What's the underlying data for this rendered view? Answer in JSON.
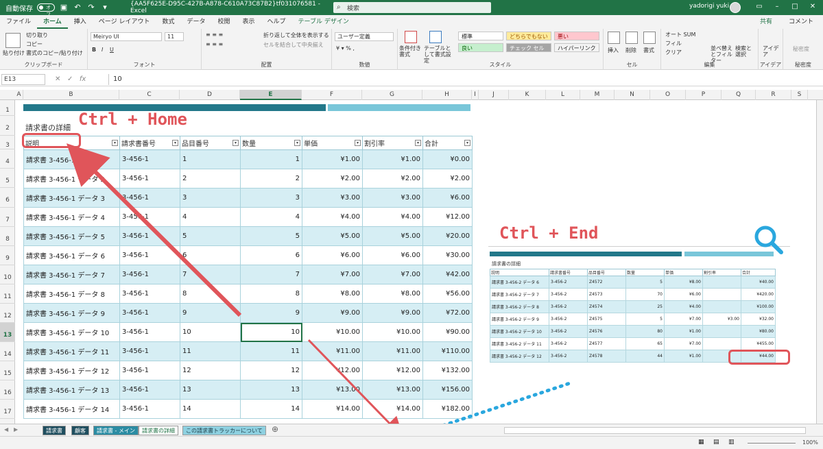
{
  "titlebar": {
    "autosave_label": "自動保存",
    "autosave_state": "オフ",
    "doc_title": "{AA5F625E-D95C-427B-A878-C610A73C87B2}tf031076581  -  Excel",
    "search_placeholder": "検索",
    "user_name": "yadorigi yuki"
  },
  "ribbon_tabs": [
    "ファイル",
    "ホーム",
    "挿入",
    "ページ レイアウト",
    "数式",
    "データ",
    "校閲",
    "表示",
    "ヘルプ",
    "テーブル デザイン"
  ],
  "ribbon_actions": {
    "share": "共有",
    "comment": "コメント"
  },
  "ribbon": {
    "clipboard": {
      "paste": "貼り付け",
      "cut": "切り取り",
      "copy": "コピー",
      "format_painter": "書式のコピー/貼り付け",
      "label": "クリップボード"
    },
    "font": {
      "font_name": "Meiryo UI",
      "font_size": "11",
      "label": "フォント"
    },
    "alignment": {
      "wrap": "折り返して全体を表示する",
      "merge": "セルを結合して中央揃え",
      "label": "配置"
    },
    "number": {
      "format": "ユーザー定義",
      "label": "数値"
    },
    "styles": {
      "conditional": "条件付き書式",
      "format_as_table": "テーブルとして書式設定",
      "cells": [
        {
          "text": "標準",
          "bg": "#ffffff",
          "fg": "#222222"
        },
        {
          "text": "どちらでもない",
          "bg": "#ffeb9c",
          "fg": "#9c5700"
        },
        {
          "text": "悪い",
          "bg": "#ffc7ce",
          "fg": "#9c0006"
        },
        {
          "text": "良い",
          "bg": "#c6efce",
          "fg": "#006100"
        },
        {
          "text": "チェック セル",
          "bg": "#a5a5a5",
          "fg": "#ffffff"
        },
        {
          "text": "ハイパーリンク",
          "bg": "#f3f3f3",
          "fg": "#222222"
        }
      ],
      "label": "スタイル"
    },
    "cells": {
      "insert": "挿入",
      "delete": "削除",
      "format": "書式",
      "label": "セル"
    },
    "editing": {
      "autosum": "オート SUM",
      "fill": "フィル",
      "clear": "クリア",
      "sort": "並べ替えとフィルター",
      "find": "検索と選択",
      "label": "編集"
    },
    "ideas": {
      "text": "アイデア",
      "label": "アイデア"
    },
    "sensitivity": {
      "text": "秘密度",
      "label": "秘密度"
    }
  },
  "formula_bar": {
    "name_box": "E13",
    "fx": "fx",
    "value": "10"
  },
  "columns": [
    "A",
    "B",
    "C",
    "D",
    "E",
    "F",
    "G",
    "H",
    "I",
    "J",
    "K",
    "L",
    "M",
    "N",
    "O",
    "P",
    "Q",
    "R",
    "S"
  ],
  "rows": [
    "1",
    "2",
    "3",
    "4",
    "5",
    "6",
    "7",
    "8",
    "9",
    "10",
    "11",
    "12",
    "13",
    "14",
    "15",
    "16",
    "17"
  ],
  "sheet": {
    "title": "請求書の詳細",
    "headers": [
      "説明",
      "請求書番号",
      "品目番号",
      "数量",
      "単価",
      "割引率",
      "合計"
    ],
    "rows": [
      [
        "請求書 3-456-1 データ 1",
        "3-456-1",
        "1",
        "1",
        "¥1.00",
        "¥1.00",
        "¥0.00"
      ],
      [
        "請求書 3-456-1 データ 2",
        "3-456-1",
        "2",
        "2",
        "¥2.00",
        "¥2.00",
        "¥2.00"
      ],
      [
        "請求書 3-456-1 データ 3",
        "3-456-1",
        "3",
        "3",
        "¥3.00",
        "¥3.00",
        "¥6.00"
      ],
      [
        "請求書 3-456-1 データ 4",
        "3-456-1",
        "4",
        "4",
        "¥4.00",
        "¥4.00",
        "¥12.00"
      ],
      [
        "請求書 3-456-1 データ 5",
        "3-456-1",
        "5",
        "5",
        "¥5.00",
        "¥5.00",
        "¥20.00"
      ],
      [
        "請求書 3-456-1 データ 6",
        "3-456-1",
        "6",
        "6",
        "¥6.00",
        "¥6.00",
        "¥30.00"
      ],
      [
        "請求書 3-456-1 データ 7",
        "3-456-1",
        "7",
        "7",
        "¥7.00",
        "¥7.00",
        "¥42.00"
      ],
      [
        "請求書 3-456-1 データ 8",
        "3-456-1",
        "8",
        "8",
        "¥8.00",
        "¥8.00",
        "¥56.00"
      ],
      [
        "請求書 3-456-1 データ 9",
        "3-456-1",
        "9",
        "9",
        "¥9.00",
        "¥9.00",
        "¥72.00"
      ],
      [
        "請求書 3-456-1 データ 10",
        "3-456-1",
        "10",
        "10",
        "¥10.00",
        "¥10.00",
        "¥90.00"
      ],
      [
        "請求書 3-456-1 データ 11",
        "3-456-1",
        "11",
        "11",
        "¥11.00",
        "¥11.00",
        "¥110.00"
      ],
      [
        "請求書 3-456-1 データ 12",
        "3-456-1",
        "12",
        "12",
        "¥12.00",
        "¥12.00",
        "¥132.00"
      ],
      [
        "請求書 3-456-1 データ 13",
        "3-456-1",
        "13",
        "13",
        "¥13.00",
        "¥13.00",
        "¥156.00"
      ],
      [
        "請求書 3-456-1 データ 14",
        "3-456-1",
        "14",
        "14",
        "¥14.00",
        "¥14.00",
        "¥182.00"
      ]
    ]
  },
  "callouts": {
    "home": "Ctrl + Home",
    "end": "Ctrl + End"
  },
  "inset": {
    "title": "請求書の詳細",
    "headers": [
      "説明",
      "請求書番号",
      "品目番号",
      "数量",
      "単価",
      "割引率",
      "合計"
    ],
    "rows": [
      [
        "請求書 3-456-2 データ 6",
        "3-456-2",
        "Z4572",
        "5",
        "¥8.00",
        "",
        "¥40.00"
      ],
      [
        "請求書 3-456-2 データ 7",
        "3-456-2",
        "Z4573",
        "70",
        "¥6.00",
        "",
        "¥420.00"
      ],
      [
        "請求書 3-456-2 データ 8",
        "3-456-2",
        "Z4574",
        "25",
        "¥4.00",
        "",
        "¥100.00"
      ],
      [
        "請求書 3-456-2 データ 9",
        "3-456-2",
        "Z4575",
        "5",
        "¥7.00",
        "¥3.00",
        "¥32.00"
      ],
      [
        "請求書 3-456-2 データ 10",
        "3-456-2",
        "Z4576",
        "80",
        "¥1.00",
        "",
        "¥80.00"
      ],
      [
        "請求書 3-456-2 データ 11",
        "3-456-2",
        "Z4577",
        "65",
        "¥7.00",
        "",
        "¥455.00"
      ],
      [
        "請求書 3-456-2 データ 12",
        "3-456-2",
        "Z4578",
        "44",
        "¥1.00",
        "",
        "¥44.00"
      ]
    ]
  },
  "sheet_tabs": [
    {
      "label": "請求書",
      "bg": "#1f4e5f",
      "fg": "#ffffff"
    },
    {
      "label": "顧客",
      "bg": "#1f4e5f",
      "fg": "#ffffff"
    },
    {
      "label": "請求書 - メイン",
      "bg": "#2b8ca3",
      "fg": "#ffffff"
    },
    {
      "label": "請求書の詳細",
      "bg": "#ffffff",
      "fg": "#217346"
    },
    {
      "label": "この請求書トラッカーについて",
      "bg": "#8ed0e0",
      "fg": "#1f3f4a"
    }
  ],
  "status": {
    "zoom": "100%"
  }
}
